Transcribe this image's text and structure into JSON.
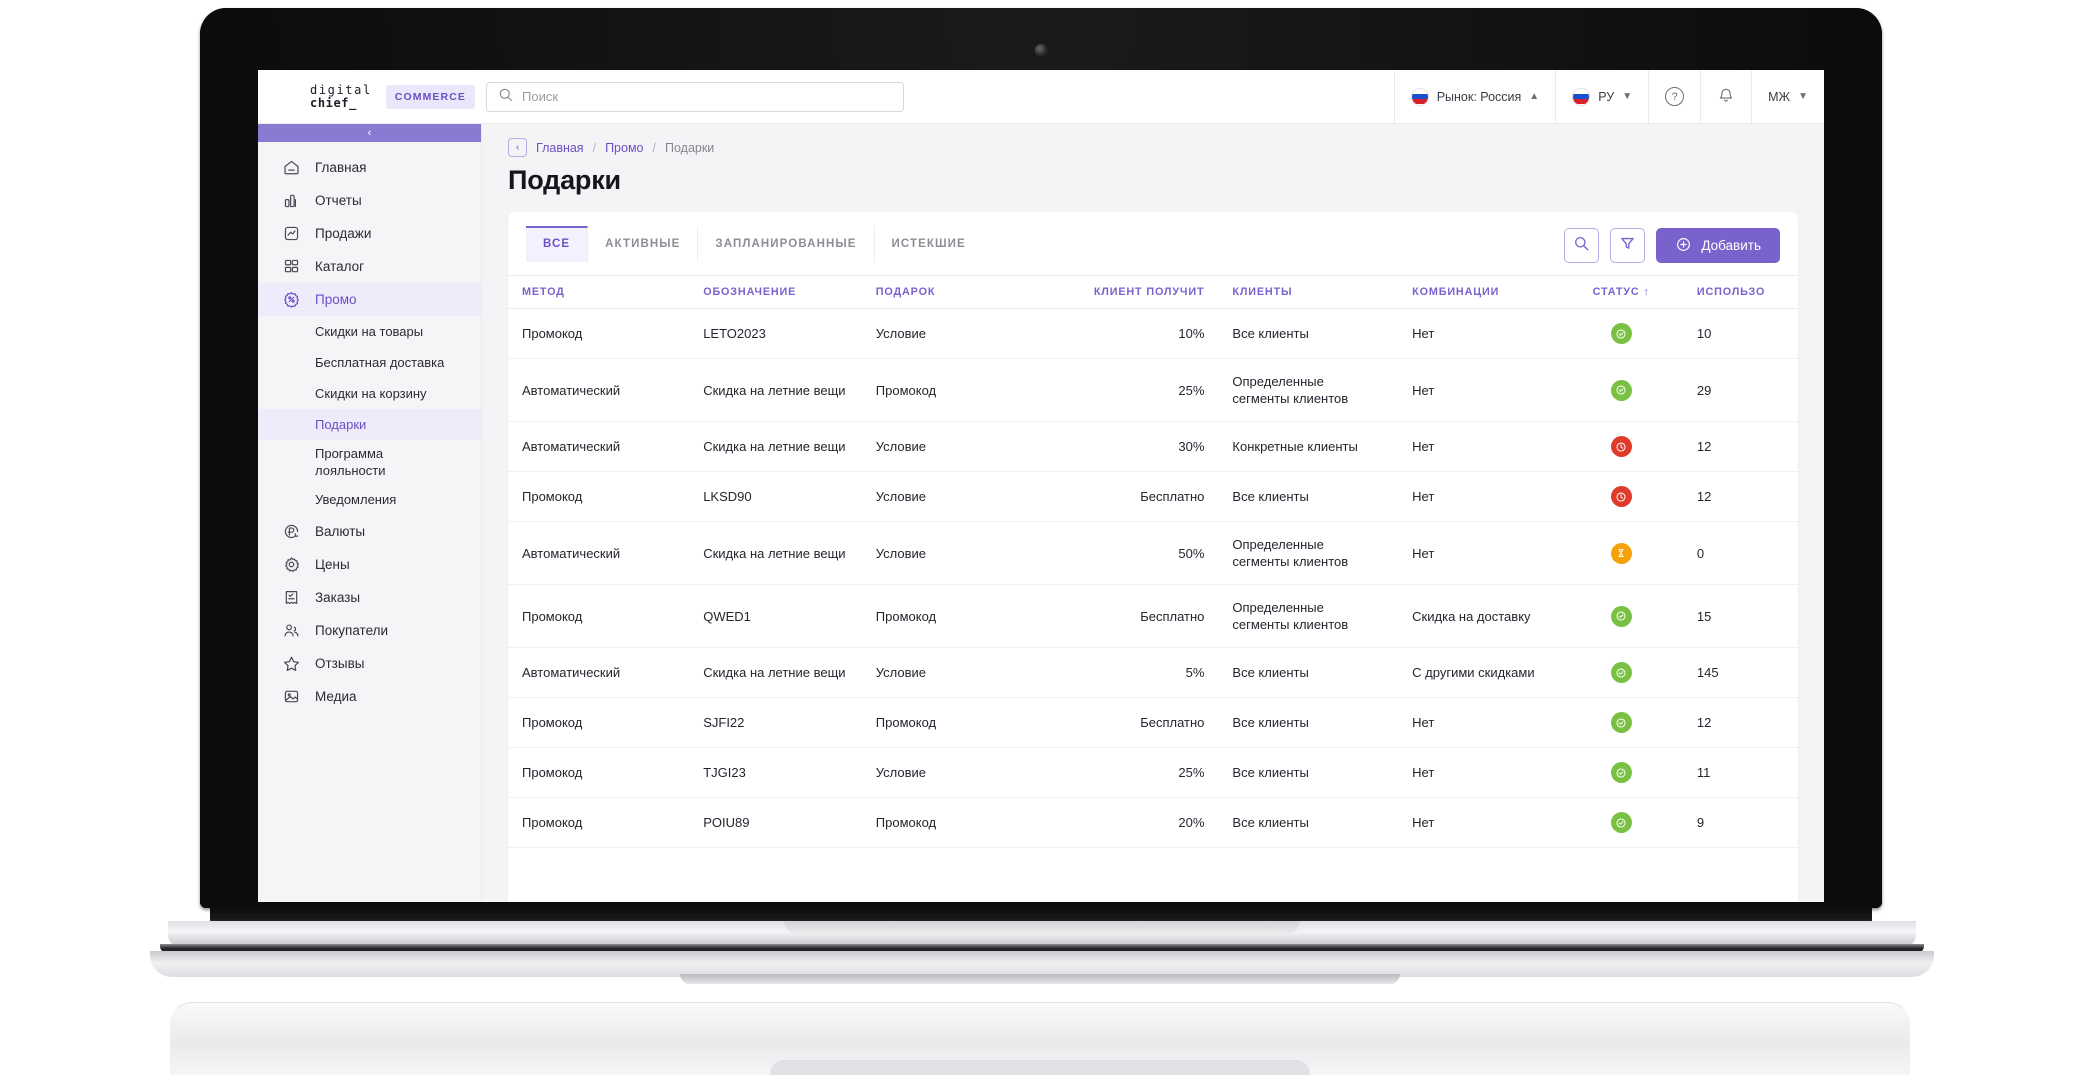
{
  "brand": {
    "logo_line1": "digital",
    "logo_line2": "chief_",
    "badge": "COMMERCE"
  },
  "search": {
    "placeholder": "Поиск",
    "value": "",
    "icon": "search-icon"
  },
  "topbar": {
    "market": "Рынок: Россия",
    "language": "РУ",
    "help_icon": "question-circle-icon",
    "bell_icon": "bell-icon",
    "user_initials": "МЖ"
  },
  "sidebar": {
    "collapse_icon": "chevron-left-icon",
    "items": [
      {
        "label": "Главная",
        "icon": "home-icon",
        "active": false
      },
      {
        "label": "Отчеты",
        "icon": "bar-chart-icon",
        "active": false
      },
      {
        "label": "Продажи",
        "icon": "trend-chart-icon",
        "active": false
      },
      {
        "label": "Каталог",
        "icon": "grid-icon",
        "active": false
      },
      {
        "label": "Промо",
        "icon": "discount-percent-icon",
        "active": true
      }
    ],
    "sub_items": [
      {
        "label": "Скидки на товары",
        "active": false
      },
      {
        "label": "Бесплатная доставка",
        "active": false
      },
      {
        "label": "Скидки на корзину",
        "active": false
      },
      {
        "label": "Подарки",
        "active": true
      },
      {
        "label": "Программа лояльности",
        "active": false,
        "line1": "Программа",
        "line2": "лояльности"
      },
      {
        "label": "Уведомления",
        "active": false
      }
    ],
    "items_after": [
      {
        "label": "Валюты",
        "icon": "ruble-icon",
        "active": false
      },
      {
        "label": "Цены",
        "icon": "gear-icon",
        "active": false
      },
      {
        "label": "Заказы",
        "icon": "receipt-icon",
        "active": false
      },
      {
        "label": "Покупатели",
        "icon": "users-icon",
        "active": false
      },
      {
        "label": "Отзывы",
        "icon": "star-icon",
        "active": false
      },
      {
        "label": "Медиа",
        "icon": "image-icon",
        "active": false
      }
    ]
  },
  "breadcrumb": {
    "back_icon": "chevron-left-icon",
    "items": [
      "Главная",
      "Промо",
      "Подарки"
    ],
    "separator": "/"
  },
  "page": {
    "title": "Подарки"
  },
  "tabs": [
    {
      "label": "ВСЕ",
      "active": true
    },
    {
      "label": "АКТИВНЫЕ",
      "active": false
    },
    {
      "label": "ЗАПЛАНИРОВАННЫЕ",
      "active": false
    },
    {
      "label": "ИСТЕКШИЕ",
      "active": false
    }
  ],
  "toolbar": {
    "search_icon": "search-icon",
    "filter_icon": "filter-icon",
    "add_label": "Добавить",
    "add_icon": "plus-circle-icon"
  },
  "colors": {
    "accent": "#7a62cd",
    "accent_light": "#eeebfb",
    "status_active": "#7ac143",
    "status_expired": "#e03a2a",
    "status_scheduled": "#f5a208"
  },
  "table": {
    "columns": [
      {
        "key": "method",
        "label": "МЕТОД",
        "align": "left"
      },
      {
        "key": "designation",
        "label": "ОБОЗНАЧЕНИЕ",
        "align": "left"
      },
      {
        "key": "gift",
        "label": "ПОДАРОК",
        "align": "left"
      },
      {
        "key": "client_gets",
        "label": "КЛИЕНТ ПОЛУЧИТ",
        "align": "right"
      },
      {
        "key": "clients",
        "label": "КЛИЕНТЫ",
        "align": "left"
      },
      {
        "key": "combinations",
        "label": "КОМБИНАЦИИ",
        "align": "left"
      },
      {
        "key": "status",
        "label": "СТАТУС ↑",
        "align": "center",
        "sorted": "asc"
      },
      {
        "key": "used",
        "label": "ИСПОЛЬЗО",
        "align": "left",
        "truncated": true
      }
    ],
    "rows": [
      {
        "method": "Промокод",
        "designation": "LETO2023",
        "gift": "Условие",
        "client_gets": "10%",
        "clients": "Все клиенты",
        "combinations": "Нет",
        "status": "active",
        "used": "10"
      },
      {
        "method": "Автоматический",
        "designation": "Скидка на летние вещи",
        "gift": "Промокод",
        "client_gets": "25%",
        "clients": "Определенные сегменты клиентов",
        "combinations": "Нет",
        "status": "active",
        "used": "29"
      },
      {
        "method": "Автоматический",
        "designation": "Скидка на летние вещи",
        "gift": "Условие",
        "client_gets": "30%",
        "clients": "Конкретные клиенты",
        "combinations": "Нет",
        "status": "expired",
        "used": "12"
      },
      {
        "method": "Промокод",
        "designation": "LKSD90",
        "gift": "Условие",
        "client_gets": "Бесплатно",
        "clients": "Все клиенты",
        "combinations": "Нет",
        "status": "expired",
        "used": "12"
      },
      {
        "method": "Автоматический",
        "designation": "Скидка на летние вещи",
        "gift": "Условие",
        "client_gets": "50%",
        "clients": "Определенные сегменты клиентов",
        "combinations": "Нет",
        "status": "scheduled",
        "used": "0"
      },
      {
        "method": "Промокод",
        "designation": "QWED1",
        "gift": "Промокод",
        "client_gets": "Бесплатно",
        "clients": "Определенные сегменты клиентов",
        "combinations": "Скидка на доставку",
        "status": "active",
        "used": "15"
      },
      {
        "method": "Автоматический",
        "designation": "Скидка на летние вещи",
        "gift": "Условие",
        "client_gets": "5%",
        "clients": "Все клиенты",
        "combinations": "С другими скидками",
        "status": "active",
        "used": "145"
      },
      {
        "method": "Промокод",
        "designation": "SJFI22",
        "gift": "Промокод",
        "client_gets": "Бесплатно",
        "clients": "Все клиенты",
        "combinations": "Нет",
        "status": "active",
        "used": "12"
      },
      {
        "method": "Промокод",
        "designation": "TJGI23",
        "gift": "Условие",
        "client_gets": "25%",
        "clients": "Все клиенты",
        "combinations": "Нет",
        "status": "active",
        "used": "11"
      },
      {
        "method": "Промокод",
        "designation": "POIU89",
        "gift": "Промокод",
        "client_gets": "20%",
        "clients": "Все клиенты",
        "combinations": "Нет",
        "status": "active",
        "used": "9"
      }
    ]
  }
}
